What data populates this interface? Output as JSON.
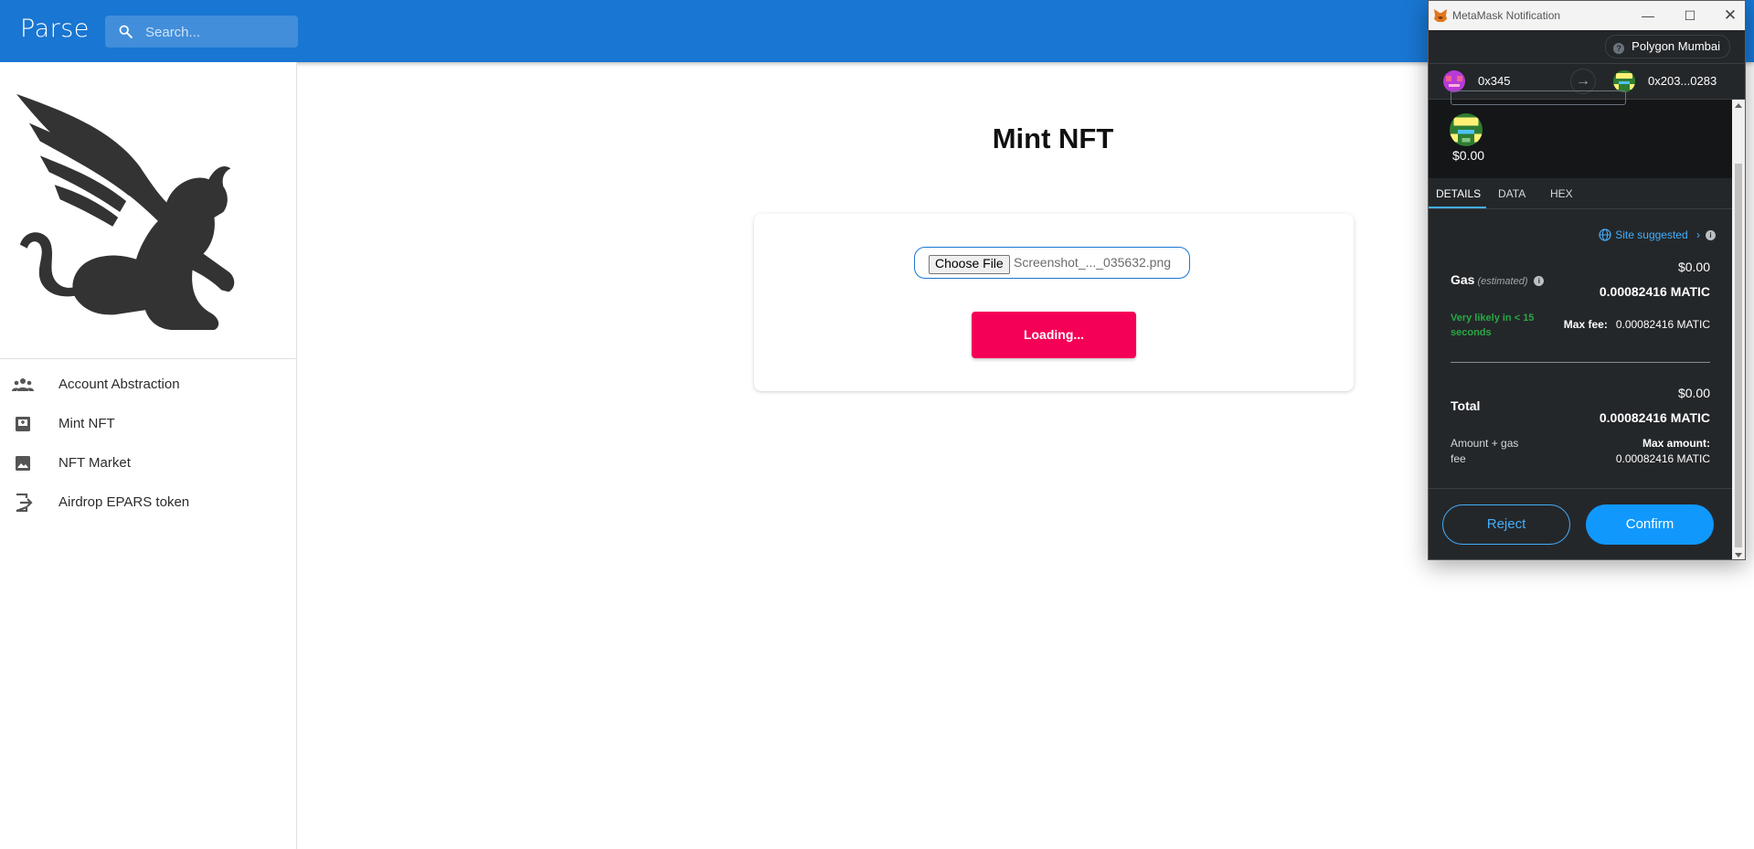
{
  "app": {
    "logo": "Parse",
    "search_placeholder": "Search..."
  },
  "sidebar": {
    "items": [
      {
        "label": "Account Abstraction",
        "icon": "people-icon"
      },
      {
        "label": "Mint NFT",
        "icon": "mint-icon"
      },
      {
        "label": "NFT Market",
        "icon": "image-icon"
      },
      {
        "label": "Airdrop EPARS token",
        "icon": "exit-to-app-icon"
      }
    ]
  },
  "main": {
    "title": "Mint NFT",
    "choose_file_label": "Choose File",
    "file_name": "Screenshot_..._035632.png",
    "submit_label": "Loading..."
  },
  "metamask": {
    "window_title": "MetaMask Notification",
    "network": "Polygon Mumbai",
    "from_account": "0x345",
    "to_account": "0x203...0283",
    "nft_value": "$0.00",
    "tabs": [
      "DETAILS",
      "DATA",
      "HEX"
    ],
    "site_suggested": "Site suggested",
    "gas": {
      "label": "Gas",
      "estimated": "(estimated)",
      "usd": "$0.00",
      "matic": "0.00082416 MATIC",
      "likely": "Very likely in < 15 seconds",
      "max_fee_label": "Max fee:",
      "max_fee_value": "0.00082416 MATIC"
    },
    "total": {
      "label": "Total",
      "usd": "$0.00",
      "matic": "0.00082416 MATIC",
      "amount_gas_label": "Amount + gas fee",
      "max_amount_label": "Max amount:",
      "max_amount_value": "0.00082416 MATIC"
    },
    "reject_label": "Reject",
    "confirm_label": "Confirm"
  },
  "colors": {
    "app_bar": "#1976d2",
    "accent_pink": "#f50057",
    "mm_background": "#24272a",
    "mm_blue": "#1098fc",
    "mm_green": "#28a745"
  }
}
